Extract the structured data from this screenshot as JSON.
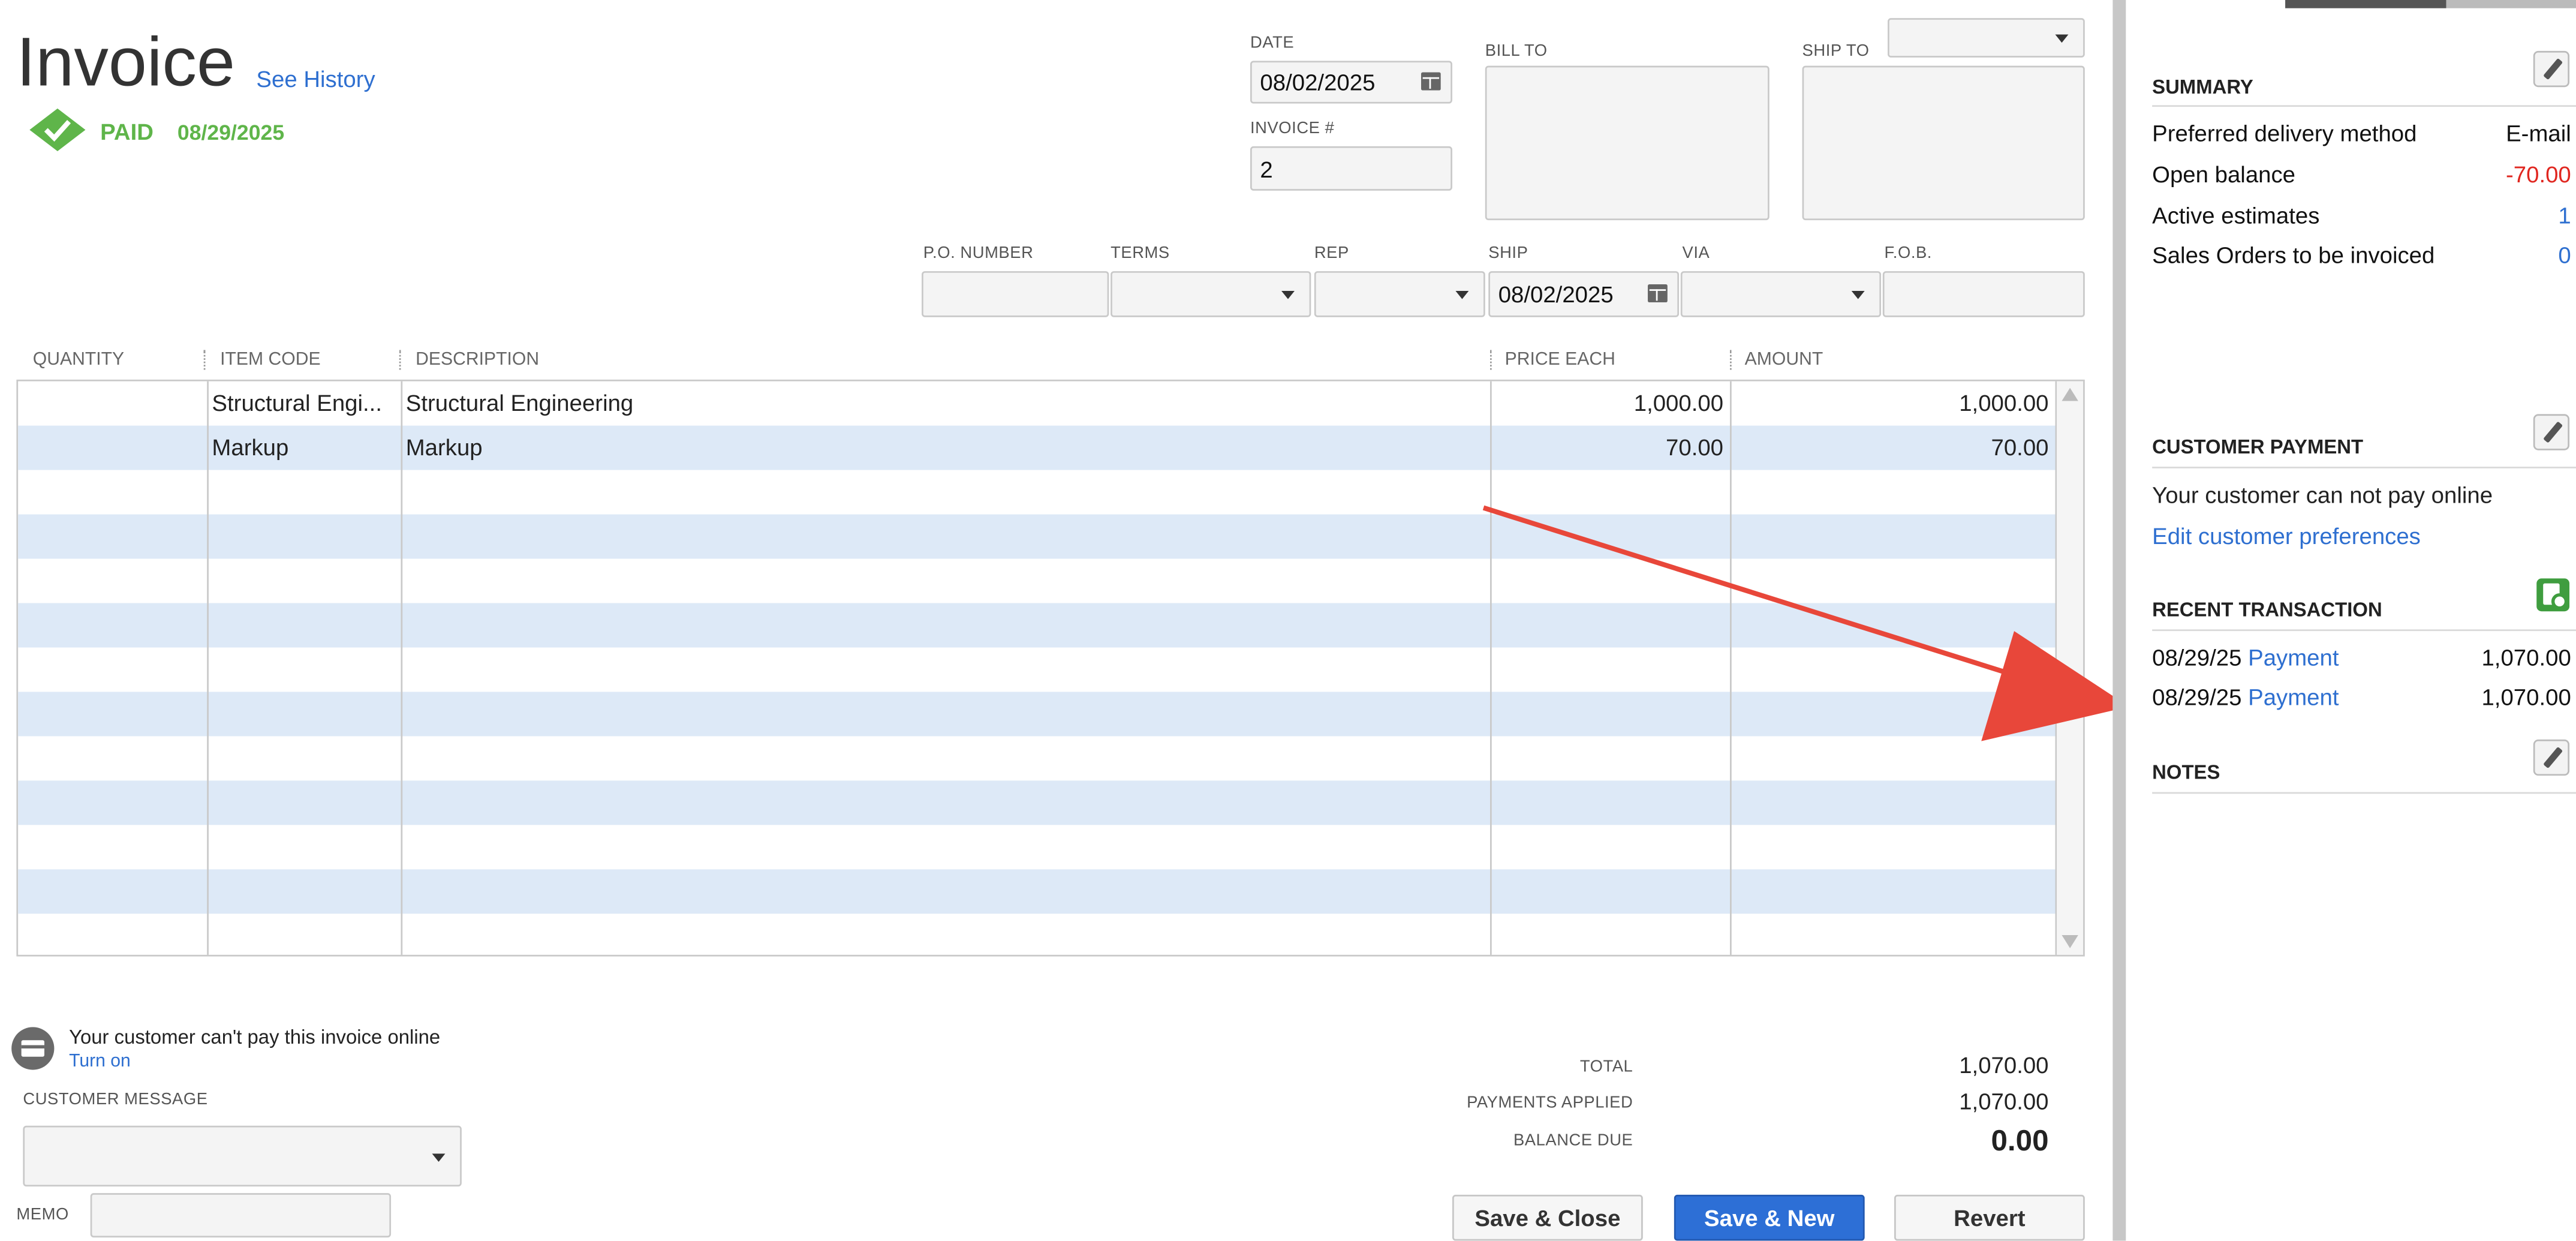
{
  "header": {
    "title": "Invoice",
    "history_link": "See History",
    "status": "PAID",
    "status_date": "08/29/2025"
  },
  "fields": {
    "date_label": "DATE",
    "date_value": "08/02/2025",
    "invoice_num_label": "INVOICE #",
    "invoice_num_value": "2",
    "bill_to_label": "BILL TO",
    "ship_to_label": "SHIP TO",
    "po_label": "P.O. NUMBER",
    "terms_label": "TERMS",
    "rep_label": "REP",
    "ship_label": "SHIP",
    "ship_value": "08/02/2025",
    "via_label": "VIA",
    "fob_label": "F.O.B."
  },
  "table": {
    "headers": [
      "QUANTITY",
      "ITEM CODE",
      "DESCRIPTION",
      "PRICE EACH",
      "AMOUNT"
    ],
    "rows": [
      {
        "quantity": "",
        "item": "Structural Engi...",
        "description": "Structural Engineering",
        "price": "1,000.00",
        "amount": "1,000.00"
      },
      {
        "quantity": "",
        "item": "Markup",
        "description": "Markup",
        "price": "70.00",
        "amount": "70.00"
      }
    ]
  },
  "footer": {
    "online_notice": "Your customer can't pay this invoice online",
    "turn_on": "Turn on",
    "customer_message_label": "CUSTOMER MESSAGE",
    "memo_label": "MEMO",
    "total_label": "TOTAL",
    "total_value": "1,070.00",
    "payments_label": "PAYMENTS APPLIED",
    "payments_value": "1,070.00",
    "balance_label": "BALANCE DUE",
    "balance_value": "0.00"
  },
  "buttons": {
    "save_close": "Save & Close",
    "save_new": "Save & New",
    "revert": "Revert"
  },
  "side": {
    "summary_title": "SUMMARY",
    "summary": [
      {
        "label": "Preferred delivery method",
        "value": "E-mail",
        "color": "#111111"
      },
      {
        "label": "Open balance",
        "value": "-70.00",
        "color": "#e0261f"
      },
      {
        "label": "Active estimates",
        "value": "1",
        "color": "#2e6fd0"
      },
      {
        "label": "Sales Orders to be invoiced",
        "value": "0",
        "color": "#2e6fd0"
      }
    ],
    "payment_title": "CUSTOMER PAYMENT",
    "payment_text": "Your customer can not pay online",
    "payment_link": "Edit customer preferences",
    "recent_title": "RECENT TRANSACTION",
    "recent": [
      {
        "date": "08/29/25",
        "type": "Payment",
        "amount": "1,070.00"
      },
      {
        "date": "08/29/25",
        "type": "Payment",
        "amount": "1,070.00"
      }
    ],
    "notes_title": "NOTES"
  },
  "colors": {
    "accent": "#2d6fd6",
    "paid": "#5fb54a",
    "annotation_arrow": "#e8473a",
    "row_stripe": "#dde9f7"
  }
}
